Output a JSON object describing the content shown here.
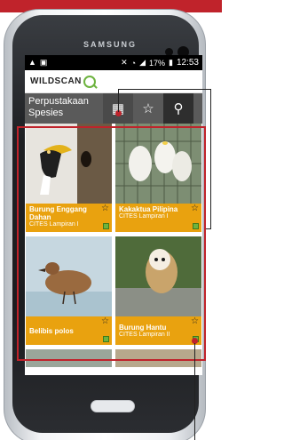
{
  "device": {
    "brand": "SAMSUNG"
  },
  "statusbar": {
    "left_icons": [
      "warning-icon",
      "image-icon"
    ],
    "battery": "17%",
    "time": "12:53"
  },
  "app": {
    "logo_text": "WILDSCAN"
  },
  "toolbar": {
    "title": "Perpustakaan Spesies",
    "buttons": [
      "grid-icon",
      "star-icon",
      "search-icon"
    ]
  },
  "species": [
    {
      "name": "Burung Enggang Dahan",
      "status": "CITES Lampiran I"
    },
    {
      "name": "Kakaktua Pilipina",
      "status": "CITES Lampiran I"
    },
    {
      "name": "Belibis polos",
      "status": ""
    },
    {
      "name": "Burung Hantu",
      "status": "CITES Lampiran II"
    }
  ],
  "colors": {
    "accent": "#c0232b",
    "caption": "#e9a20f",
    "toolbar": "#5a5a5a",
    "tag": "#6db33f"
  }
}
